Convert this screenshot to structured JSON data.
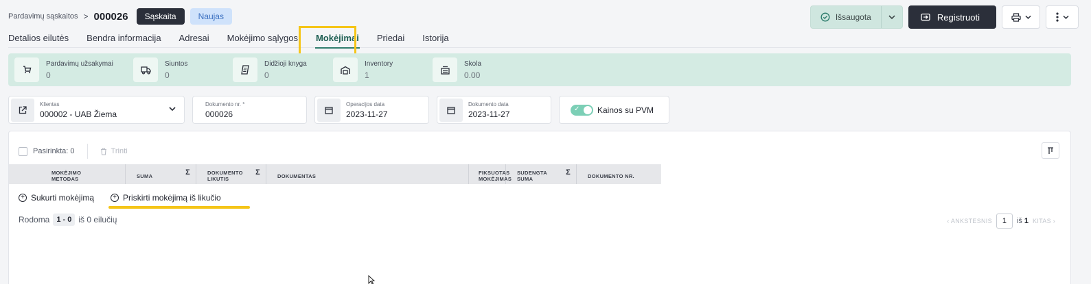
{
  "header": {
    "breadcrumb_parent": "Pardavimų sąskaitos",
    "separator": ">",
    "document_number": "000026",
    "doc_type_badge": "Sąskaita",
    "status_badge": "Naujas",
    "saved_label": "Išsaugota",
    "register_label": "Registruoti"
  },
  "tabs": [
    {
      "label": "Detalios eilutės"
    },
    {
      "label": "Bendra informacija"
    },
    {
      "label": "Adresai"
    },
    {
      "label": "Mokėjimo sąlygos"
    },
    {
      "label": "Mokėjimai",
      "active": true
    },
    {
      "label": "Priedai"
    },
    {
      "label": "Istorija"
    }
  ],
  "stats": [
    {
      "label": "Pardavimų užsakymai",
      "value": "0",
      "icon": "cart-icon"
    },
    {
      "label": "Siuntos",
      "value": "0",
      "icon": "truck-icon"
    },
    {
      "label": "Didžioji knyga",
      "value": "0",
      "icon": "book-icon"
    },
    {
      "label": "Inventory",
      "value": "1",
      "icon": "inventory-icon"
    },
    {
      "label": "Skola",
      "value": "0.00",
      "icon": "debt-icon"
    }
  ],
  "fields": {
    "client": {
      "label": "Klientas",
      "value": "000002 - UAB Žiema"
    },
    "document_no": {
      "label": "Dokumento nr. *",
      "value": "000026"
    },
    "operation_date": {
      "label": "Operacijos data",
      "value": "2023-11-27"
    },
    "document_date": {
      "label": "Dokumento data",
      "value": "2023-11-27"
    },
    "prices_vat": {
      "label": "Kainos su PVM",
      "checked": true
    }
  },
  "table": {
    "selected_label": "Pasirinkta: 0",
    "delete_label": "Trinti",
    "columns": [
      {
        "label": "MOKĖJIMO METODAS",
        "sum": false
      },
      {
        "label": "SUMA",
        "sum": true
      },
      {
        "label": "DOKUMENTO LIKUTIS",
        "sum": true
      },
      {
        "label": "DOKUMENTAS",
        "sum": false
      },
      {
        "label": "FIKSUOTAS MOKĖJIMAS",
        "sum": false
      },
      {
        "label": "SUDENGTA SUMA",
        "sum": true
      },
      {
        "label": "DOKUMENTO NR.",
        "sum": false
      }
    ],
    "sum_symbol": "Σ",
    "rows": []
  },
  "actions": {
    "create_payment": "Sukurti mokėjimą",
    "assign_payment": "Priskirti mokėjimą iš likučio"
  },
  "pagination": {
    "showing_label": "Rodoma",
    "range": "1 - 0",
    "of_rows": "iš 0 eilučių",
    "prev_label": "ANKSTESNIS",
    "current_page": "1",
    "of_label": "iš",
    "total_pages": "1",
    "next_label": "KITAS"
  },
  "colors": {
    "accent": "#2f7d6d",
    "highlight": "#f5c518",
    "stats_bg": "#d4ebe3",
    "dark_button": "#2b2f3a"
  }
}
